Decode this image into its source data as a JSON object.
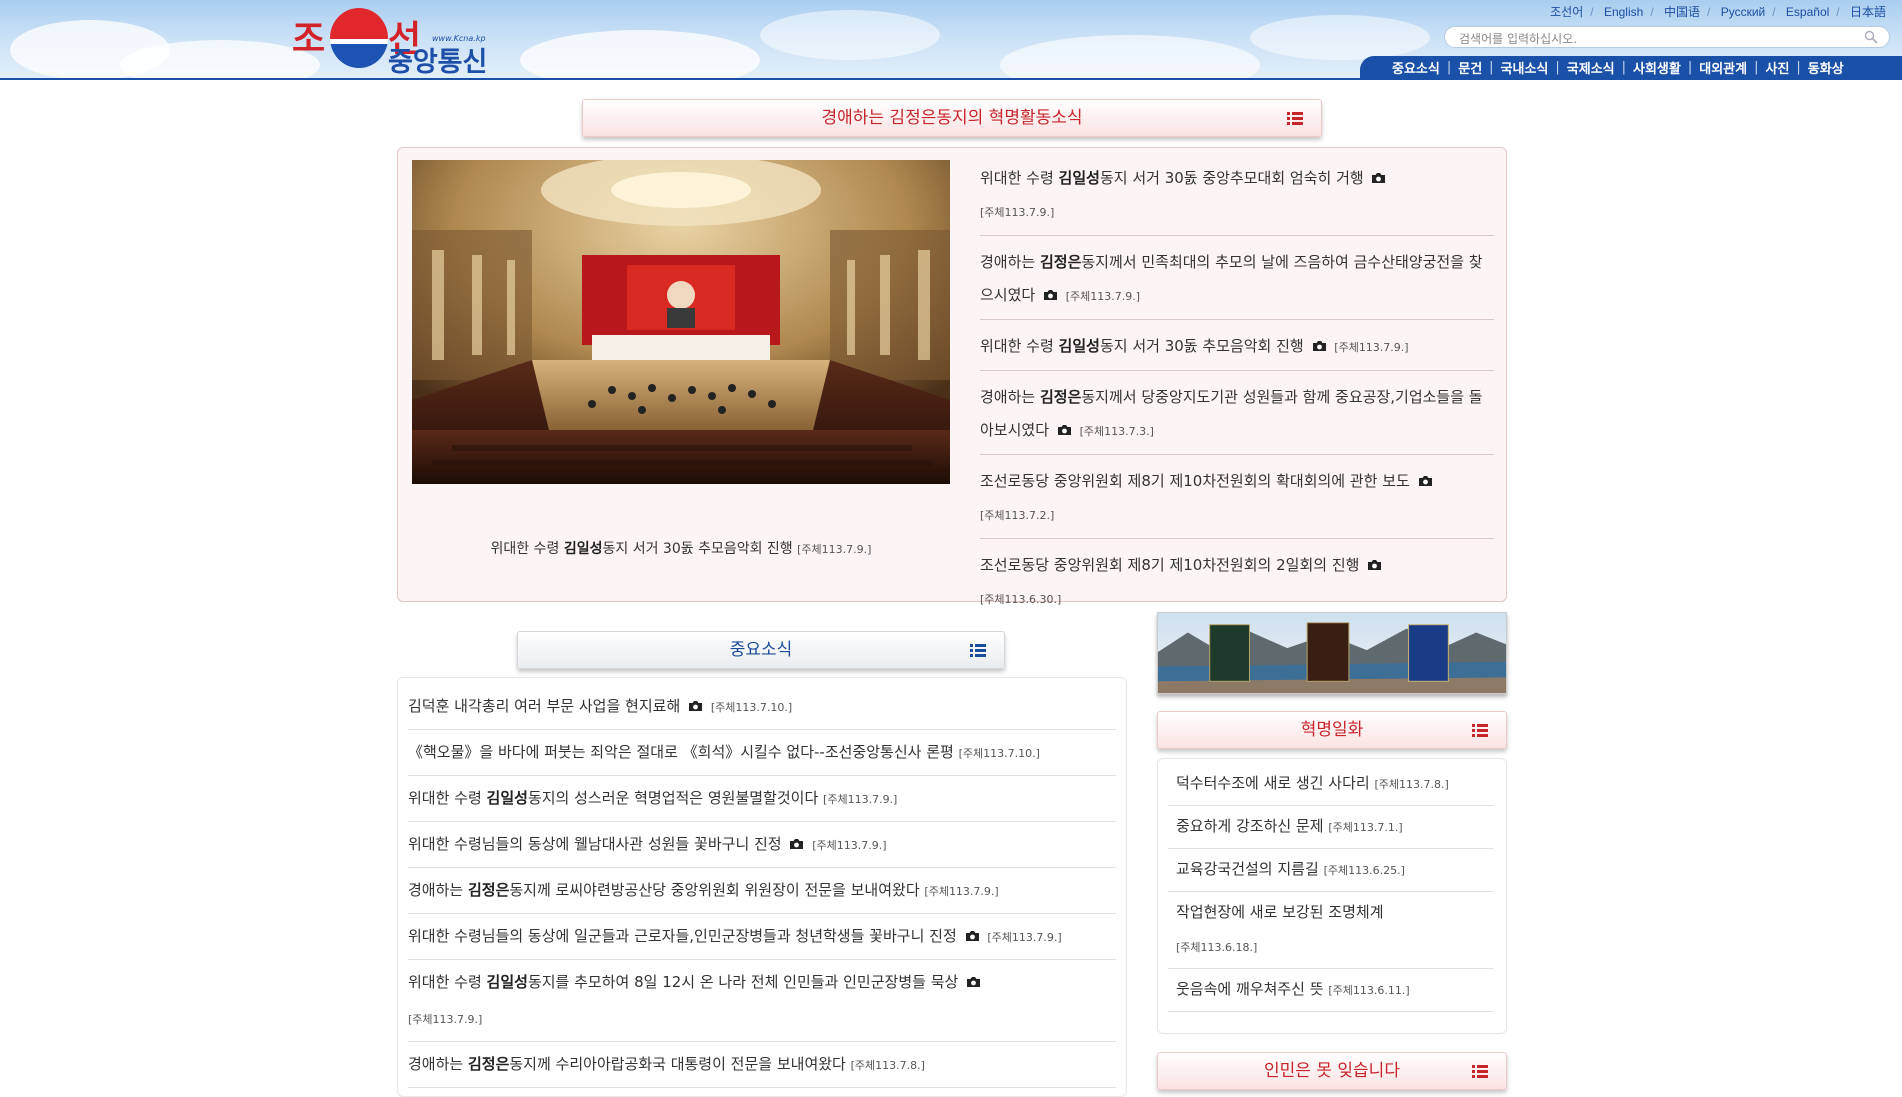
{
  "logo": {
    "top": "조",
    "top2": "선",
    "bottom": "중앙통신",
    "url": "www.Kcna.kp"
  },
  "languages": [
    "조선어",
    "English",
    "中国语",
    "Русский",
    "Español",
    "日本語"
  ],
  "search": {
    "placeholder": "검색어를 입력하십시오."
  },
  "nav": [
    "중요소식",
    "문건",
    "국내소식",
    "국제소식",
    "사회생활",
    "대외관계",
    "사진",
    "동화상"
  ],
  "top_section": {
    "title": "경애하는 김정은동지의 혁명활동소식",
    "photo_caption": {
      "pre": "위대한 수령 ",
      "bold": "김일성",
      "post": "동지 서거 30돐 추모음악회 진행",
      "date": "[주체113.7.9.]"
    },
    "items": [
      {
        "pre": "위대한 수령 ",
        "bold": "김일성",
        "post": "동지 서거 30돐 중앙추모대회 엄숙히 거행",
        "date": "[주체113.7.9.]"
      },
      {
        "pre": "경애하는 ",
        "bold": "김정은",
        "post": "동지께서 민족최대의 추모의 날에 즈음하여 금수산태양궁전을 찾으시였다",
        "date": "[주체113.7.9.]"
      },
      {
        "pre": "위대한 수령 ",
        "bold": "김일성",
        "post": "동지 서거 30돐 추모음악회 진행",
        "date": "[주체113.7.9.]"
      },
      {
        "pre": "경애하는 ",
        "bold": "김정은",
        "post": "동지께서 당중앙지도기관 성원들과 함께 중요공장,기업소들을 돌아보시였다",
        "date": "[주체113.7.3.]"
      },
      {
        "pre": "조선로동당 중앙위원회 제8기 제10차전원회의 확대회의에 관한 보도",
        "bold": "",
        "post": "",
        "date": "[주체113.7.2.]"
      },
      {
        "pre": "조선로동당 중앙위원회 제8기 제10차전원회의 2일회의 진행",
        "bold": "",
        "post": "",
        "date": "[주체113.6.30.]"
      }
    ]
  },
  "main_section": {
    "title": "중요소식",
    "items": [
      {
        "pre": "김덕훈 내각총리 여러 부문 사업을 현지료해",
        "bold": "",
        "post": "",
        "date": "[주체113.7.10.]",
        "camera": true
      },
      {
        "pre": "《핵오물》을 바다에 퍼붓는 죄악은 절대로 《희석》시킬수 없다--조선중앙통신사 론평",
        "bold": "",
        "post": "",
        "date": "[주체113.7.10.]",
        "camera": false
      },
      {
        "pre": "위대한 수령 ",
        "bold": "김일성",
        "post": "동지의 성스러운 혁명업적은 영원불멸할것이다",
        "date": "[주체113.7.9.]",
        "camera": false
      },
      {
        "pre": "위대한 수령님들의 동상에 웰남대사관 성원들 꽃바구니 진정",
        "bold": "",
        "post": "",
        "date": "[주체113.7.9.]",
        "camera": true
      },
      {
        "pre": "경애하는 ",
        "bold": "김정은",
        "post": "동지께 로씨야련방공산당 중앙위원회 위원장이 전문을 보내여왔다",
        "date": "[주체113.7.9.]",
        "camera": false
      },
      {
        "pre": "위대한 수령님들의 동상에 일군들과 근로자들,인민군장병들과 청년학생들 꽃바구니 진정",
        "bold": "",
        "post": "",
        "date": "[주체113.7.9.]",
        "camera": true
      },
      {
        "pre": "위대한 수령 ",
        "bold": "김일성",
        "post": "동지를 추모하여 8일 12시 온 나라 전체 인민들과 인민군장병들 묵상",
        "date": "[주체113.7.9.]",
        "camera": true
      },
      {
        "pre": "경애하는 ",
        "bold": "김정은",
        "post": "동지께 수리아아랍공화국 대통령이 전문을 보내여왔다",
        "date": "[주체113.7.8.]",
        "camera": false
      }
    ]
  },
  "side_section": {
    "title": "혁명일화",
    "items": [
      {
        "text": "덕수터수조에 새로 생긴 사다리",
        "date": "[주체113.7.8.]"
      },
      {
        "text": "중요하게 강조하신 문제",
        "date": "[주체113.7.1.]"
      },
      {
        "text": "교육강국건설의 지름길",
        "date": "[주체113.6.25.]"
      },
      {
        "text": "작업현장에 새로 보강된 조명체계",
        "date": "[주체113.6.18.]"
      },
      {
        "text": "웃음속에 깨우쳐주신 뜻",
        "date": "[주체113.6.11.]"
      }
    ]
  },
  "bottom_section": {
    "title": "인민은 못 잊습니다"
  },
  "colors": {
    "accent_red": "#c8242c",
    "nav_blue": "#1a50a8",
    "title_blue": "#1c4c9c"
  }
}
